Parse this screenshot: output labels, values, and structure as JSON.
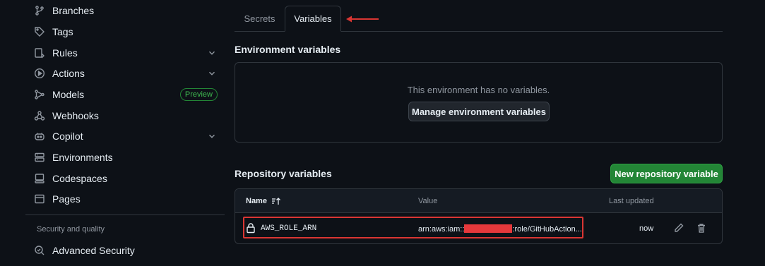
{
  "sidebar": {
    "items": [
      {
        "label": "Branches",
        "icon": "branch-icon"
      },
      {
        "label": "Tags",
        "icon": "tag-icon"
      },
      {
        "label": "Rules",
        "icon": "rules-icon"
      },
      {
        "label": "Actions",
        "icon": "play-icon"
      },
      {
        "label": "Models",
        "icon": "models-icon",
        "badge": "Preview"
      },
      {
        "label": "Webhooks",
        "icon": "webhook-icon"
      },
      {
        "label": "Copilot",
        "icon": "copilot-icon"
      },
      {
        "label": "Environments",
        "icon": "server-icon"
      },
      {
        "label": "Codespaces",
        "icon": "codespaces-icon"
      },
      {
        "label": "Pages",
        "icon": "browser-icon"
      }
    ],
    "section_title": "Security and quality",
    "advanced_security": "Advanced Security"
  },
  "tabs": [
    {
      "label": "Secrets",
      "active": false
    },
    {
      "label": "Variables",
      "active": true
    }
  ],
  "environment": {
    "title": "Environment variables",
    "empty_text": "This environment has no variables.",
    "manage_button": "Manage environment variables"
  },
  "repository": {
    "title": "Repository variables",
    "new_button": "New repository variable",
    "columns": {
      "name": "Name",
      "value": "Value",
      "updated": "Last updated"
    },
    "rows": [
      {
        "name": "AWS_ROLE_ARN",
        "value_prefix": "arn:aws:iam::",
        "value_suffix": ":role/GitHubAction...",
        "updated": "now"
      }
    ]
  },
  "colors": {
    "accent_green": "#238636",
    "annotation_red": "#da3633"
  }
}
